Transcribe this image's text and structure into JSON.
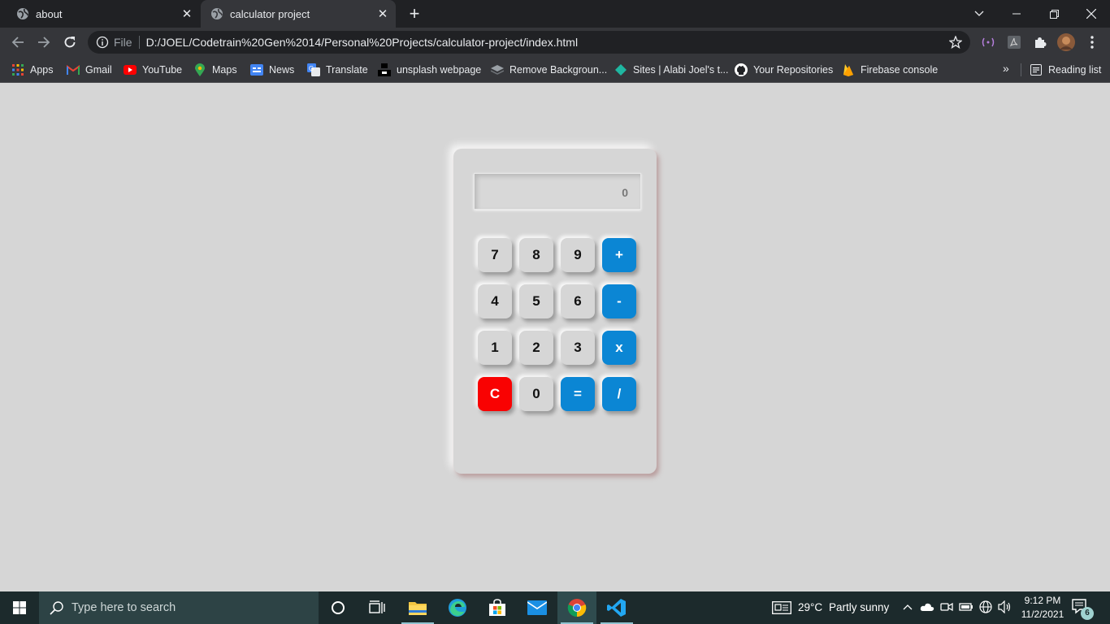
{
  "browser": {
    "tabs": [
      {
        "title": "about",
        "active": false
      },
      {
        "title": "calculator project",
        "active": true
      }
    ],
    "omnibox": {
      "scheme_label": "File",
      "url": "D:/JOEL/Codetrain%20Gen%2014/Personal%20Projects/calculator-project/index.html"
    },
    "bookmarks": [
      {
        "label": "Apps",
        "icon": "apps-grid-icon"
      },
      {
        "label": "Gmail",
        "icon": "gmail-icon"
      },
      {
        "label": "YouTube",
        "icon": "youtube-icon"
      },
      {
        "label": "Maps",
        "icon": "maps-icon"
      },
      {
        "label": "News",
        "icon": "news-icon"
      },
      {
        "label": "Translate",
        "icon": "translate-icon"
      },
      {
        "label": "unsplash webpage",
        "icon": "unsplash-icon"
      },
      {
        "label": "Remove Backgroun...",
        "icon": "removebg-icon"
      },
      {
        "label": "Sites | Alabi Joel's t...",
        "icon": "sites-icon"
      },
      {
        "label": "Your Repositories",
        "icon": "github-icon"
      },
      {
        "label": "Firebase console",
        "icon": "firebase-icon"
      }
    ],
    "overflow_label": "»",
    "reading_list_label": "Reading list"
  },
  "calculator": {
    "display_value": "0",
    "keys": [
      {
        "label": "7",
        "kind": "digit"
      },
      {
        "label": "8",
        "kind": "digit"
      },
      {
        "label": "9",
        "kind": "digit"
      },
      {
        "label": "+",
        "kind": "operator"
      },
      {
        "label": "4",
        "kind": "digit"
      },
      {
        "label": "5",
        "kind": "digit"
      },
      {
        "label": "6",
        "kind": "digit"
      },
      {
        "label": "-",
        "kind": "operator"
      },
      {
        "label": "1",
        "kind": "digit"
      },
      {
        "label": "2",
        "kind": "digit"
      },
      {
        "label": "3",
        "kind": "digit"
      },
      {
        "label": "x",
        "kind": "operator"
      },
      {
        "label": "C",
        "kind": "clear"
      },
      {
        "label": "0",
        "kind": "digit"
      },
      {
        "label": "=",
        "kind": "operator"
      },
      {
        "label": "/",
        "kind": "operator"
      }
    ]
  },
  "taskbar": {
    "search_placeholder": "Type here to search",
    "weather": {
      "temp": "29°C",
      "condition": "Partly sunny"
    },
    "clock": {
      "time": "9:12 PM",
      "date": "11/2/2021"
    },
    "notification_count": "6"
  },
  "colors": {
    "page_background": "#d6d6d6",
    "operator_key": "#0b86d4",
    "clear_key": "#f90202"
  }
}
